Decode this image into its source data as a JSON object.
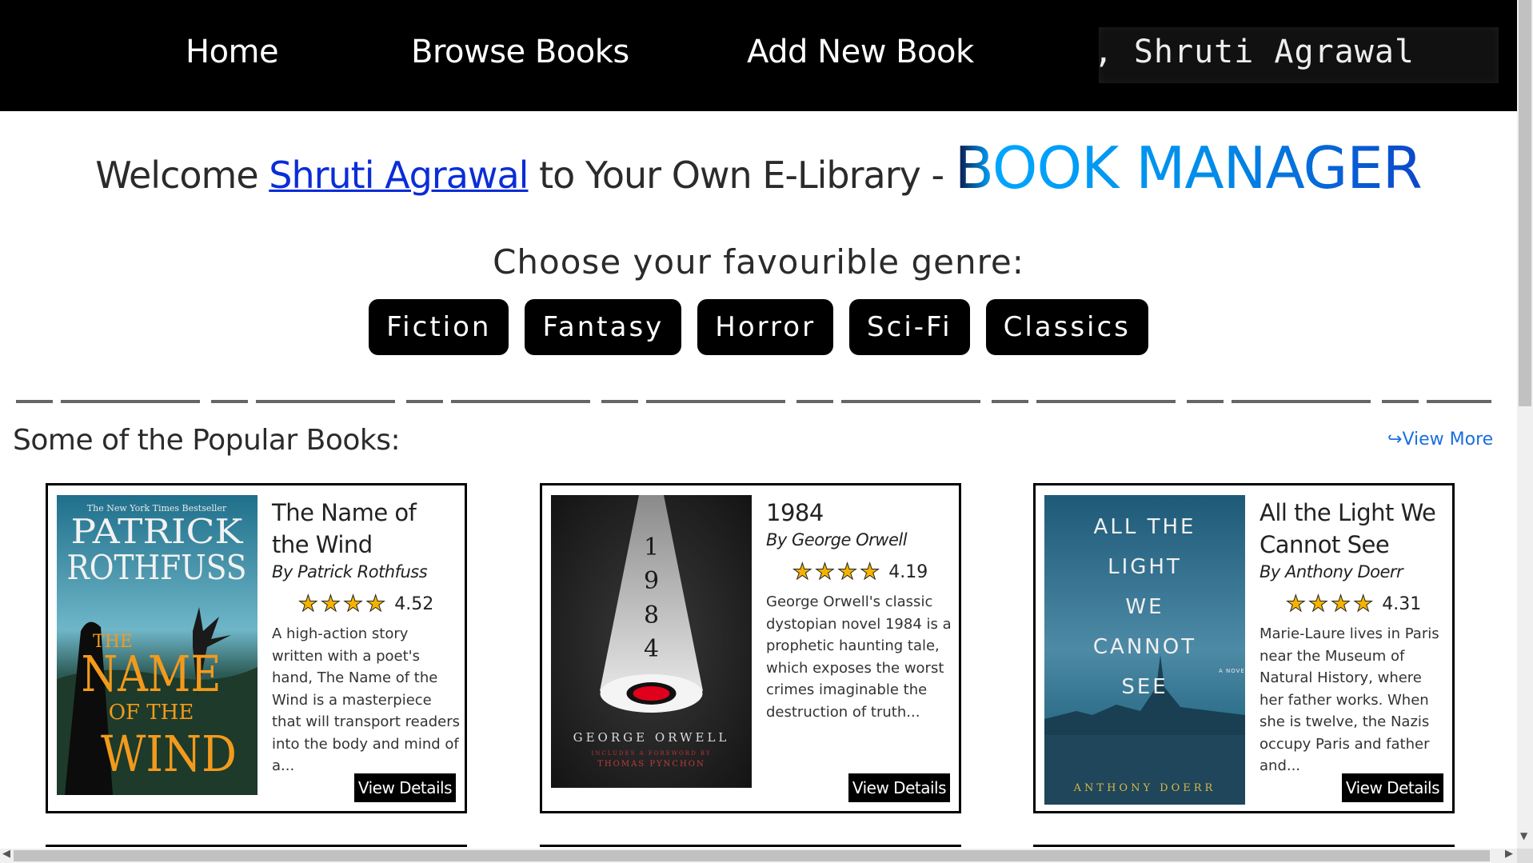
{
  "nav": {
    "home": "Home",
    "browse": "Browse Books",
    "add": "Add New Book",
    "greeting": "Hey, Shruti Agrawal"
  },
  "welcome": {
    "prefix": "Welcome ",
    "user": "Shruti Agrawal",
    "suffix": " to Your Own E-Library - ",
    "brand": "BOOK MANAGER"
  },
  "genre_heading": "Choose your favourible genre:",
  "genres": [
    "Fiction",
    "Fantasy",
    "Horror",
    "Sci-Fi",
    "Classics"
  ],
  "popular": {
    "title": "Some of the Popular Books:",
    "view_more": "View More",
    "view_more_icon": "redo-arrow-icon"
  },
  "books": [
    {
      "title": "The Name of the Wind",
      "author": "By Patrick Rothfuss",
      "stars": 4,
      "rating": "4.52",
      "description": "A high-action story written with a poet's hand, The Name of the Wind is a masterpiece that will transport readers into the body and mind of a...",
      "button": "View Details",
      "cover": {
        "top_line": "The New York Times Bestseller",
        "author_line1": "PATRICK",
        "author_line2": "ROTHFUSS",
        "title_a": "THE",
        "title_b": "NAME",
        "title_c": "OF THE",
        "title_d": "WIND"
      }
    },
    {
      "title": "1984",
      "author": "By George Orwell",
      "stars": 4,
      "rating": "4.19",
      "description": "George Orwell's classic dystopian novel 1984 is a prophetic haunting tale, which exposes the worst crimes imaginable the destruction of truth...",
      "button": "View Details",
      "cover": {
        "digits": [
          "1",
          "9",
          "8",
          "4"
        ],
        "author": "GEORGE ORWELL",
        "foreword": "INCLUDES A FOREWORD BY",
        "foreword_by": "THOMAS PYNCHON"
      }
    },
    {
      "title": "All the Light We Cannot See",
      "author": "By Anthony Doerr",
      "stars": 4,
      "rating": "4.31",
      "description": "Marie-Laure lives in Paris near the Museum of Natural History, where her father works. When she is twelve, the Nazis occupy Paris and father and...",
      "button": "View Details",
      "cover": {
        "lines": [
          "ALL THE",
          "LIGHT",
          "WE",
          "CANNOT",
          "SEE"
        ],
        "side": "A NOVEL",
        "author": "ANTHONY DOERR"
      }
    }
  ],
  "colors": {
    "nav_bg": "#000000",
    "link": "#0a2dd8",
    "brand_start": "#00a6ff",
    "brand_end": "#0d47c9",
    "star": "#f5b301",
    "view_more": "#1a6fe0"
  }
}
